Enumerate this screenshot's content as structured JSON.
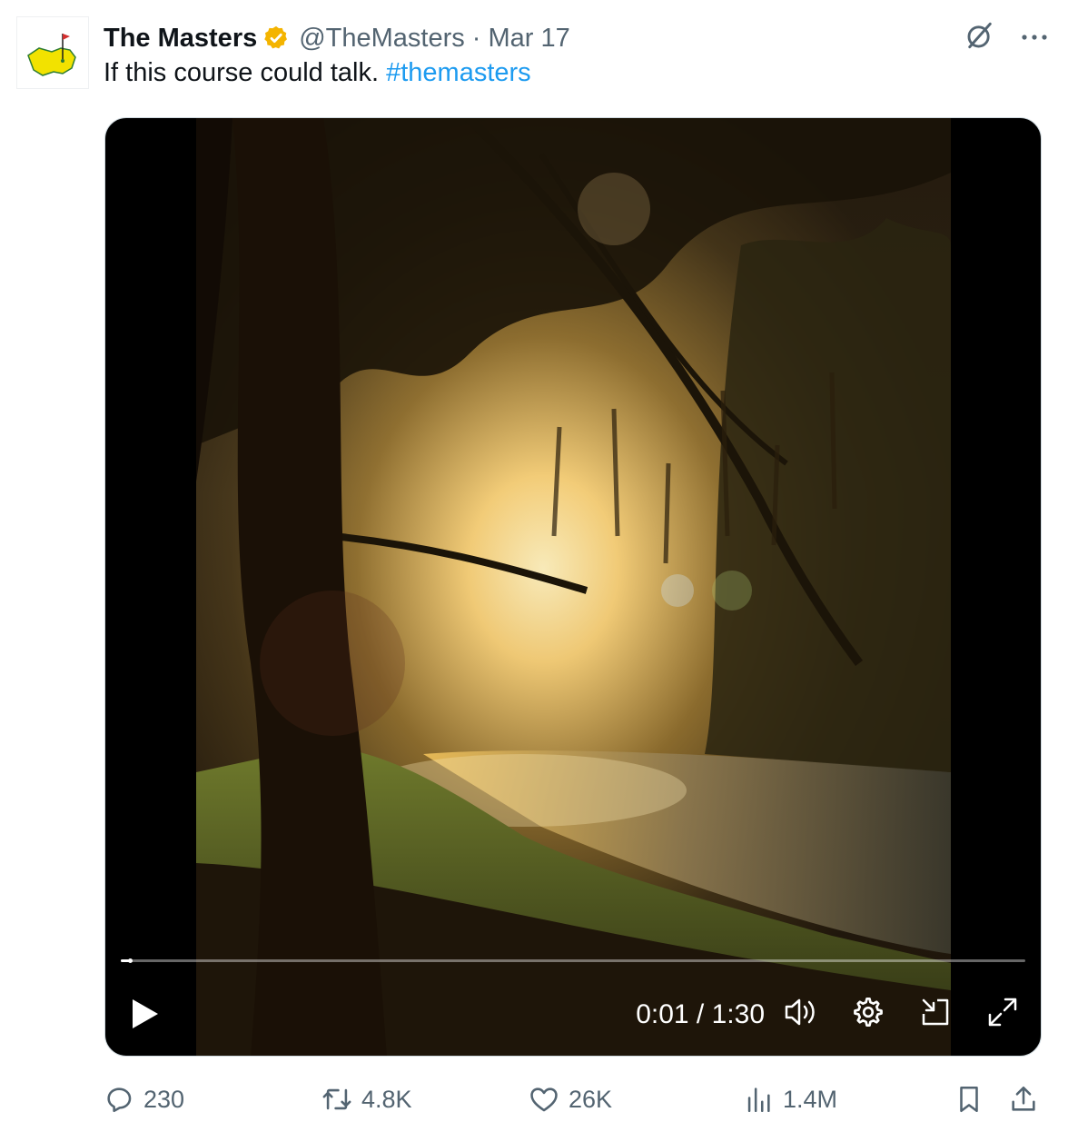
{
  "tweet": {
    "author_name": "The Masters",
    "handle": "@TheMasters",
    "separator": "·",
    "date": "Mar 17",
    "text": "If this course could talk. ",
    "hashtag": "#themasters"
  },
  "video": {
    "current_time": "0:01",
    "time_separator": " / ",
    "duration": "1:30",
    "progress_fraction": 0.01
  },
  "actions": {
    "replies": "230",
    "reposts": "4.8K",
    "likes": "26K",
    "views": "1.4M"
  },
  "colors": {
    "accent": "#1d9bf0",
    "verified_badge": "#f4b400",
    "secondary_text": "#536471"
  },
  "icons": [
    "masters-logo-icon",
    "verified-badge-icon",
    "grok-icon",
    "more-icon",
    "play-icon",
    "volume-icon",
    "settings-icon",
    "pip-icon",
    "fullscreen-icon",
    "reply-icon",
    "repost-icon",
    "like-icon",
    "views-icon",
    "bookmark-icon",
    "share-icon"
  ]
}
